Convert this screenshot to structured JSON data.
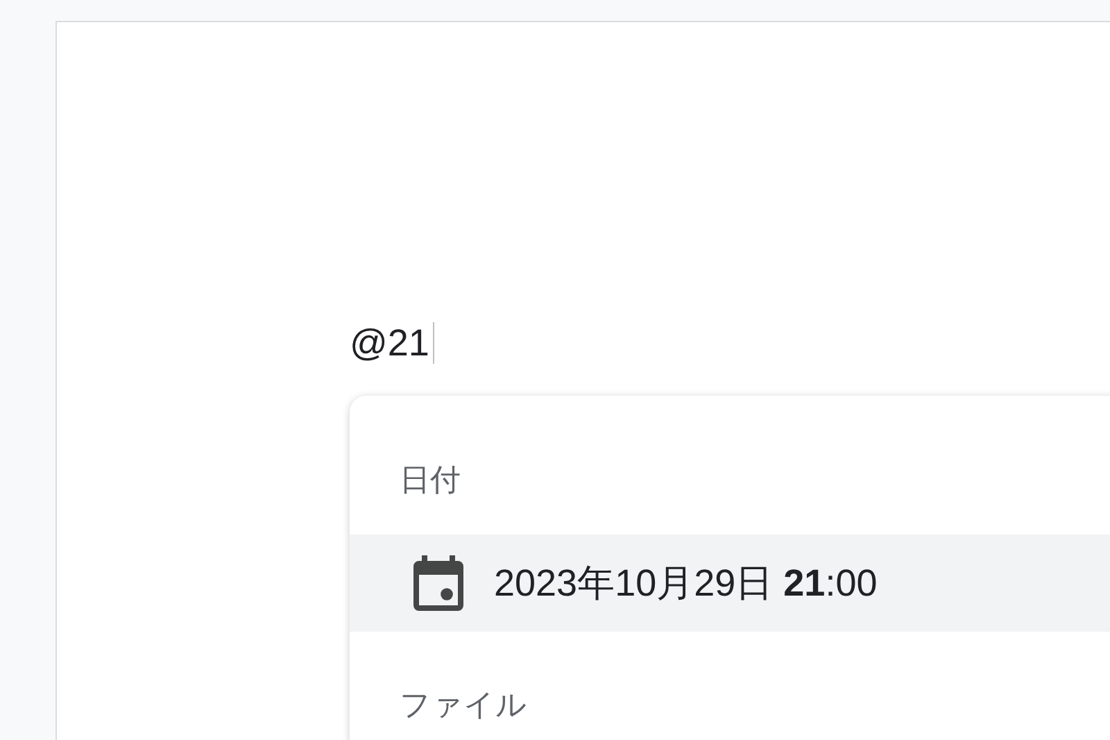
{
  "editor": {
    "text": "@21"
  },
  "menu": {
    "sections": [
      {
        "heading": "日付",
        "items": [
          {
            "kind": "date",
            "label": "2023年10月29日 **21**:00",
            "selected": true
          }
        ]
      },
      {
        "heading": "ファイル"
      }
    ]
  }
}
